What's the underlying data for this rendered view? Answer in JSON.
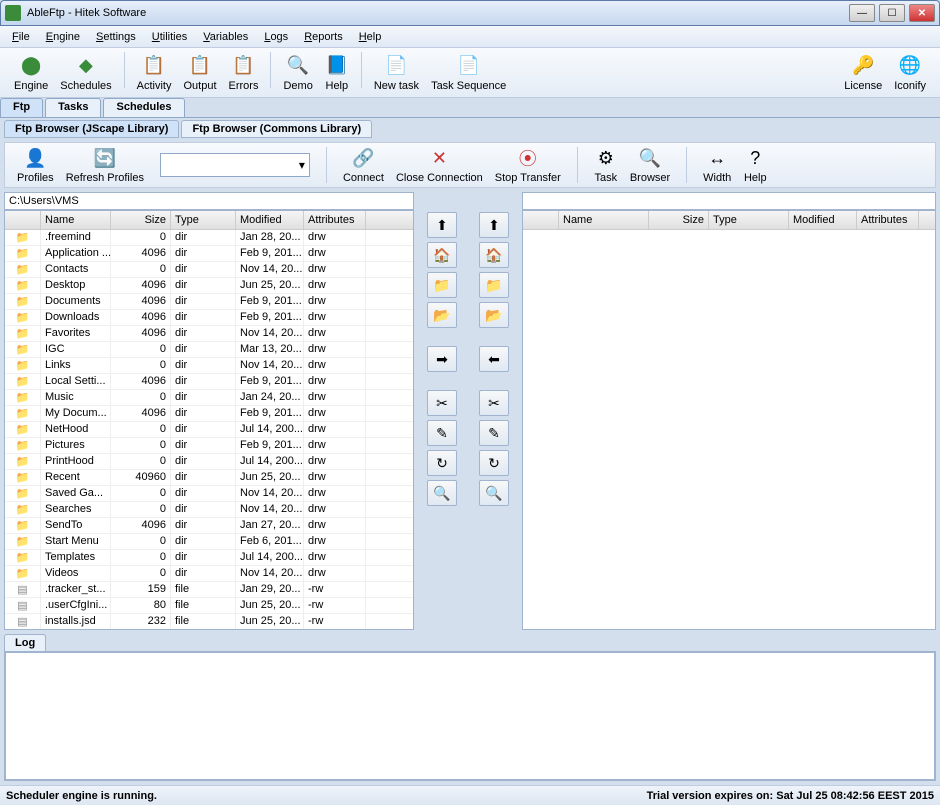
{
  "title": "AbleFtp    - Hitek Software",
  "menu": [
    "File",
    "Engine",
    "Settings",
    "Utilities",
    "Variables",
    "Logs",
    "Reports",
    "Help"
  ],
  "toolbar": [
    {
      "label": "Engine",
      "icon": "⬤",
      "color": "#3a8c3a"
    },
    {
      "label": "Schedules",
      "icon": "◆",
      "color": "#3a8c3a"
    },
    {
      "label": "Activity",
      "icon": "📋",
      "color": "#e8a020"
    },
    {
      "label": "Output",
      "icon": "📋",
      "color": "#888"
    },
    {
      "label": "Errors",
      "icon": "📋",
      "color": "#c33"
    },
    {
      "label": "Demo",
      "icon": "🔍",
      "color": "#557"
    },
    {
      "label": "Help",
      "icon": "📘",
      "color": "#557"
    },
    {
      "label": "New task",
      "icon": "📄",
      "color": "#e8a020"
    },
    {
      "label": "Task Sequence",
      "icon": "📄",
      "color": "#e8a020"
    }
  ],
  "toolbar_right": [
    {
      "label": "License",
      "icon": "🔑",
      "color": "#e8a020"
    },
    {
      "label": "Iconify",
      "icon": "🌐",
      "color": "#3a6acc"
    }
  ],
  "tabs": [
    "Ftp",
    "Tasks",
    "Schedules"
  ],
  "subtabs": [
    "Ftp Browser (JScape Library)",
    "Ftp Browser (Commons Library)"
  ],
  "actions": [
    {
      "label": "Profiles",
      "icon": "👤"
    },
    {
      "label": "Refresh Profiles",
      "icon": "🔄"
    }
  ],
  "actions2": [
    {
      "label": "Connect",
      "icon": "🔗"
    },
    {
      "label": "Close Connection",
      "icon": "✕",
      "color": "#c33"
    },
    {
      "label": "Stop Transfer",
      "icon": "⦿",
      "color": "#c33"
    }
  ],
  "actions3": [
    {
      "label": "Task",
      "icon": "⚙"
    },
    {
      "label": "Browser",
      "icon": "🔍"
    }
  ],
  "actions4": [
    {
      "label": "Width",
      "icon": "↔"
    },
    {
      "label": "Help",
      "icon": "?"
    }
  ],
  "path": "C:\\Users\\VMS",
  "columns": [
    "",
    "Name",
    "Size",
    "Type",
    "Modified",
    "Attributes"
  ],
  "files": [
    {
      "icon": "folder",
      "name": ".freemind",
      "size": "0",
      "type": "dir",
      "mod": "Jan 28, 20...",
      "attr": "drw"
    },
    {
      "icon": "folder",
      "name": "Application ...",
      "size": "4096",
      "type": "dir",
      "mod": "Feb 9, 201...",
      "attr": "drw"
    },
    {
      "icon": "folder",
      "name": "Contacts",
      "size": "0",
      "type": "dir",
      "mod": "Nov 14, 20...",
      "attr": "drw"
    },
    {
      "icon": "folder",
      "name": "Desktop",
      "size": "4096",
      "type": "dir",
      "mod": "Jun 25, 20...",
      "attr": "drw"
    },
    {
      "icon": "folder",
      "name": "Documents",
      "size": "4096",
      "type": "dir",
      "mod": "Feb 9, 201...",
      "attr": "drw"
    },
    {
      "icon": "folder",
      "name": "Downloads",
      "size": "4096",
      "type": "dir",
      "mod": "Feb 9, 201...",
      "attr": "drw"
    },
    {
      "icon": "folder",
      "name": "Favorites",
      "size": "4096",
      "type": "dir",
      "mod": "Nov 14, 20...",
      "attr": "drw"
    },
    {
      "icon": "folder",
      "name": "IGC",
      "size": "0",
      "type": "dir",
      "mod": "Mar 13, 20...",
      "attr": "drw"
    },
    {
      "icon": "folder",
      "name": "Links",
      "size": "0",
      "type": "dir",
      "mod": "Nov 14, 20...",
      "attr": "drw"
    },
    {
      "icon": "folder",
      "name": "Local Setti...",
      "size": "4096",
      "type": "dir",
      "mod": "Feb 9, 201...",
      "attr": "drw"
    },
    {
      "icon": "folder",
      "name": "Music",
      "size": "0",
      "type": "dir",
      "mod": "Jan 24, 20...",
      "attr": "drw"
    },
    {
      "icon": "folder",
      "name": "My Docum...",
      "size": "4096",
      "type": "dir",
      "mod": "Feb 9, 201...",
      "attr": "drw"
    },
    {
      "icon": "folder",
      "name": "NetHood",
      "size": "0",
      "type": "dir",
      "mod": "Jul 14, 200...",
      "attr": "drw"
    },
    {
      "icon": "folder",
      "name": "Pictures",
      "size": "0",
      "type": "dir",
      "mod": "Feb 9, 201...",
      "attr": "drw"
    },
    {
      "icon": "folder",
      "name": "PrintHood",
      "size": "0",
      "type": "dir",
      "mod": "Jul 14, 200...",
      "attr": "drw"
    },
    {
      "icon": "folder",
      "name": "Recent",
      "size": "40960",
      "type": "dir",
      "mod": "Jun 25, 20...",
      "attr": "drw"
    },
    {
      "icon": "folder",
      "name": "Saved Ga...",
      "size": "0",
      "type": "dir",
      "mod": "Nov 14, 20...",
      "attr": "drw"
    },
    {
      "icon": "folder",
      "name": "Searches",
      "size": "0",
      "type": "dir",
      "mod": "Nov 14, 20...",
      "attr": "drw"
    },
    {
      "icon": "folder",
      "name": "SendTo",
      "size": "4096",
      "type": "dir",
      "mod": "Jan 27, 20...",
      "attr": "drw"
    },
    {
      "icon": "folder",
      "name": "Start Menu",
      "size": "0",
      "type": "dir",
      "mod": "Feb 6, 201...",
      "attr": "drw"
    },
    {
      "icon": "folder",
      "name": "Templates",
      "size": "0",
      "type": "dir",
      "mod": "Jul 14, 200...",
      "attr": "drw"
    },
    {
      "icon": "folder",
      "name": "Videos",
      "size": "0",
      "type": "dir",
      "mod": "Nov 14, 20...",
      "attr": "drw"
    },
    {
      "icon": "file",
      "name": ".tracker_st...",
      "size": "159",
      "type": "file",
      "mod": "Jan 29, 20...",
      "attr": "-rw"
    },
    {
      "icon": "file",
      "name": ".userCfgIni...",
      "size": "80",
      "type": "file",
      "mod": "Jun 25, 20...",
      "attr": "-rw"
    },
    {
      "icon": "file",
      "name": "installs.jsd",
      "size": "232",
      "type": "file",
      "mod": "Jun 25, 20...",
      "attr": "-rw"
    }
  ],
  "mid_left": [
    "⬆",
    "🏠",
    "📁",
    "📂",
    "",
    "➡",
    "",
    "✂",
    "✎",
    "↻",
    "🔍"
  ],
  "mid_right": [
    "⬆",
    "🏠",
    "📁",
    "📂",
    "",
    "⬅",
    "",
    "✂",
    "✎",
    "↻",
    "🔍"
  ],
  "log_tab": "Log",
  "status_left": "Scheduler engine is running.",
  "status_right": "Trial version expires on: Sat Jul 25 08:42:56 EEST 2015"
}
